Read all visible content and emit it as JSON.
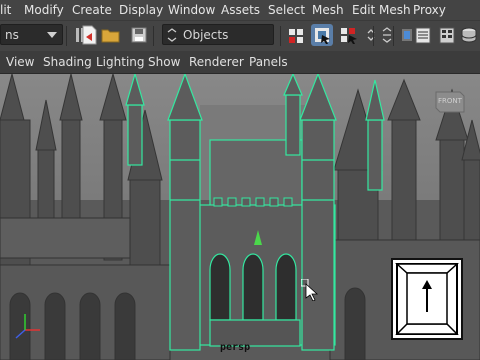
{
  "menubar": {
    "items": [
      "lit",
      "Modify",
      "Create",
      "Display",
      "Window",
      "Assets",
      "Select",
      "Mesh",
      "Edit Mesh",
      "Proxy"
    ]
  },
  "toolbar": {
    "mode_combo": "ns",
    "objects_combo": "Objects"
  },
  "panel_menu": {
    "items": [
      "View",
      "Shading",
      "Lighting",
      "Show",
      "Renderer",
      "Panels"
    ]
  },
  "viewport": {
    "camera_label": "persp",
    "viewcube_label": "FRONT"
  },
  "colors": {
    "selection_wire": "#34e8a0",
    "menu_bg": "#444444",
    "viewport_bg": "#6e6e6e"
  },
  "icons": [
    "dropdown-arrow-icon",
    "shelf-menu-icon",
    "new-scene-icon",
    "open-scene-icon",
    "save-scene-icon",
    "selection-mask-icon",
    "select-by-hierarchy-icon",
    "select-by-object-icon",
    "select-by-component-icon",
    "snap-menu-icon",
    "attribute-editor-icon",
    "channel-box-icon",
    "render-settings-icon",
    "up-arrow-key-icon",
    "mouse-cursor-icon"
  ]
}
